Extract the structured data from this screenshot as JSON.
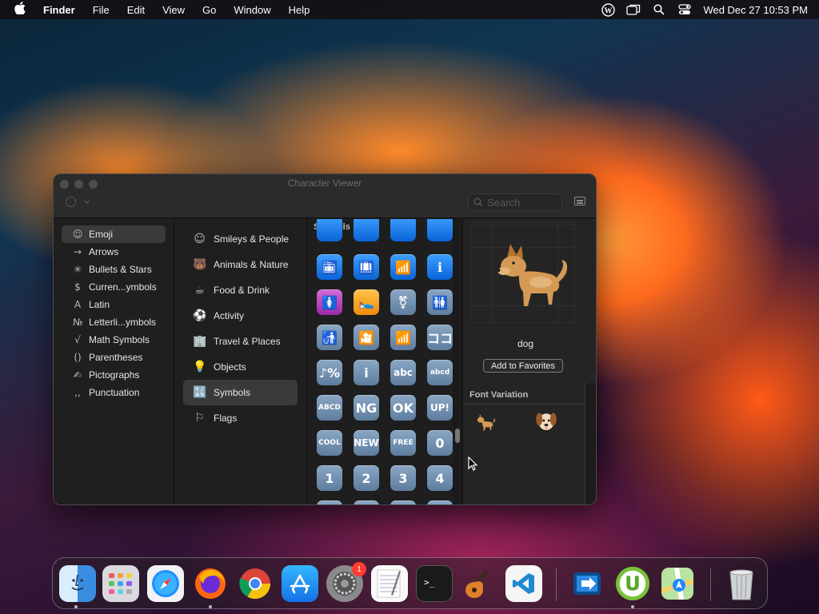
{
  "menubar": {
    "app_name": "Finder",
    "items": [
      "File",
      "Edit",
      "View",
      "Go",
      "Window",
      "Help"
    ],
    "clock": "Wed Dec 27  10:53 PM"
  },
  "window": {
    "title": "Character Viewer",
    "search_placeholder": "Search",
    "categories": [
      {
        "label": "Emoji",
        "icon": "smiley-icon",
        "glyph": "☺"
      },
      {
        "label": "Arrows",
        "icon": "arrow-icon",
        "glyph": "→"
      },
      {
        "label": "Bullets & Stars",
        "icon": "star-icon",
        "glyph": "✳"
      },
      {
        "label": "Curren...ymbols",
        "icon": "dollar-icon",
        "glyph": "$"
      },
      {
        "label": "Latin",
        "icon": "latin-a-icon",
        "glyph": "A"
      },
      {
        "label": "Letterli...ymbols",
        "icon": "numero-icon",
        "glyph": "№"
      },
      {
        "label": "Math Symbols",
        "icon": "sqrt-icon",
        "glyph": "√"
      },
      {
        "label": "Parentheses",
        "icon": "parentheses-icon",
        "glyph": "()"
      },
      {
        "label": "Pictographs",
        "icon": "pictograph-icon",
        "glyph": "✍"
      },
      {
        "label": "Punctuation",
        "icon": "punctuation-icon",
        "glyph": ",,"
      }
    ],
    "subcategories": [
      {
        "label": "Smileys & People",
        "icon": "smiley-icon",
        "glyph": "☺"
      },
      {
        "label": "Animals & Nature",
        "icon": "bear-icon",
        "glyph": "🐻"
      },
      {
        "label": "Food & Drink",
        "icon": "cup-icon",
        "glyph": "☕"
      },
      {
        "label": "Activity",
        "icon": "ball-icon",
        "glyph": "⚽"
      },
      {
        "label": "Travel & Places",
        "icon": "building-icon",
        "glyph": "🏢"
      },
      {
        "label": "Objects",
        "icon": "bulb-icon",
        "glyph": "💡"
      },
      {
        "label": "Symbols",
        "icon": "symbols-icon",
        "glyph": "🔣"
      },
      {
        "label": "Flags",
        "icon": "flag-icon",
        "glyph": "⚐"
      }
    ],
    "grid_header": "Symbols",
    "symbols": [
      {
        "t": "🛅",
        "c": "blue"
      },
      {
        "t": "🛄",
        "c": "blue"
      },
      {
        "t": "📶",
        "c": "blue"
      },
      {
        "t": "ℹ",
        "c": "blue"
      },
      {
        "t": "🚺",
        "c": "purple"
      },
      {
        "t": "🛌",
        "c": "orange"
      },
      {
        "t": "⚧",
        "c": ""
      },
      {
        "t": "🚻",
        "c": ""
      },
      {
        "t": "🚮",
        "c": ""
      },
      {
        "t": "🎦",
        "c": ""
      },
      {
        "t": "📶",
        "c": ""
      },
      {
        "t": "ココ",
        "c": ""
      },
      {
        "t": "♪%",
        "c": ""
      },
      {
        "t": "i",
        "c": ""
      },
      {
        "t": "abc",
        "c": ""
      },
      {
        "t": "abcd",
        "c": ""
      },
      {
        "t": "ABCD",
        "c": ""
      },
      {
        "t": "NG",
        "c": ""
      },
      {
        "t": "OK",
        "c": ""
      },
      {
        "t": "UP!",
        "c": ""
      },
      {
        "t": "COOL",
        "c": ""
      },
      {
        "t": "NEW",
        "c": ""
      },
      {
        "t": "FREE",
        "c": ""
      },
      {
        "t": "0",
        "c": ""
      },
      {
        "t": "1",
        "c": ""
      },
      {
        "t": "2",
        "c": ""
      },
      {
        "t": "3",
        "c": ""
      },
      {
        "t": "4",
        "c": ""
      }
    ],
    "preview": {
      "name": "dog",
      "add_favorites": "Add to Favorites",
      "font_variation_title": "Font Variation"
    }
  },
  "dock": {
    "apps": [
      "Finder",
      "Launchpad",
      "Safari",
      "Firefox",
      "Chrome",
      "App Store",
      "System Settings",
      "TextEdit",
      "Terminal",
      "GarageBand",
      "Visual Studio Code",
      "Migration",
      "uTorrent",
      "Maps",
      "Trash"
    ],
    "settings_badge": "1"
  }
}
